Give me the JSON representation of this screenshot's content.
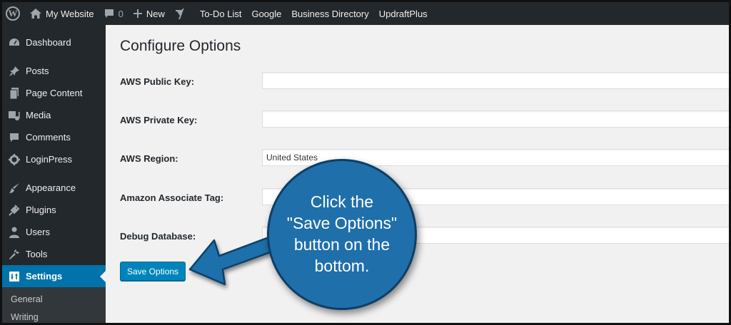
{
  "admin_bar": {
    "site_name": "My Website",
    "comments_count": "0",
    "new_label": "New",
    "links": [
      "To-Do List",
      "Google",
      "Business Directory",
      "UpdraftPlus"
    ]
  },
  "sidebar": {
    "items": [
      {
        "label": "Dashboard",
        "icon": "dashboard-icon"
      },
      {
        "label": "Posts",
        "icon": "pin-icon"
      },
      {
        "label": "Page Content",
        "icon": "pages-icon"
      },
      {
        "label": "Media",
        "icon": "media-icon"
      },
      {
        "label": "Comments",
        "icon": "comment-icon"
      },
      {
        "label": "LoginPress",
        "icon": "gear-icon"
      },
      {
        "label": "Appearance",
        "icon": "brush-icon"
      },
      {
        "label": "Plugins",
        "icon": "plug-icon"
      },
      {
        "label": "Users",
        "icon": "user-icon"
      },
      {
        "label": "Tools",
        "icon": "wrench-icon"
      },
      {
        "label": "Settings",
        "icon": "settings-icon"
      }
    ],
    "submenu": [
      "General",
      "Writing"
    ]
  },
  "main": {
    "title": "Configure Options",
    "fields": [
      {
        "label": "AWS Public Key:",
        "value": ""
      },
      {
        "label": "AWS Private Key:",
        "value": ""
      },
      {
        "label": "AWS Region:",
        "value": "United States"
      },
      {
        "label": "Amazon Associate Tag:",
        "value": ""
      },
      {
        "label": "Debug Database:",
        "value": ""
      }
    ],
    "save_label": "Save Options"
  },
  "callout": {
    "lines": [
      "Click the",
      "\"Save Options\"",
      "button on the",
      "bottom."
    ]
  },
  "colors": {
    "accent": "#0073aa",
    "button": "#0085ba",
    "callout": "#1f6fab",
    "sidebar": "#23282d",
    "content_bg": "#f1f1f1"
  }
}
